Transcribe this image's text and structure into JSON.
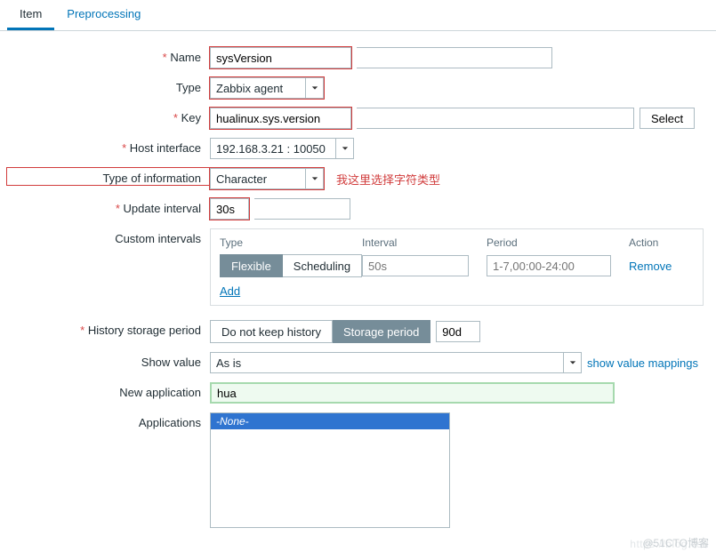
{
  "tabs": {
    "item": "Item",
    "preprocessing": "Preprocessing"
  },
  "labels": {
    "name": "Name",
    "type": "Type",
    "key": "Key",
    "host_interface": "Host interface",
    "type_of_info": "Type of information",
    "update_interval": "Update interval",
    "custom_intervals": "Custom intervals",
    "history_storage": "History storage period",
    "show_value": "Show value",
    "new_application": "New application",
    "applications": "Applications"
  },
  "fields": {
    "name": "sysVersion",
    "type": "Zabbix agent",
    "key": "hualinux.sys.version",
    "host_interface": "192.168.3.21 : 10050",
    "type_of_info": "Character",
    "update_interval": "30s",
    "history_period": "90d",
    "show_value": "As is",
    "new_application": "hua",
    "applications_none": "-None-"
  },
  "custom_intervals": {
    "headers": {
      "type": "Type",
      "interval": "Interval",
      "period": "Period",
      "action": "Action"
    },
    "seg_flexible": "Flexible",
    "seg_scheduling": "Scheduling",
    "interval_ph": "50s",
    "period_ph": "1-7,00:00-24:00",
    "remove": "Remove",
    "add": "Add"
  },
  "history_seg": {
    "do_not_keep": "Do not keep history",
    "storage_period": "Storage period"
  },
  "buttons": {
    "select": "Select"
  },
  "links": {
    "show_value_mappings": "show value mappings"
  },
  "annotation": "我这里选择字符类型",
  "watermark_faint": "https://blog.csd",
  "watermark": "@51CTO博客"
}
